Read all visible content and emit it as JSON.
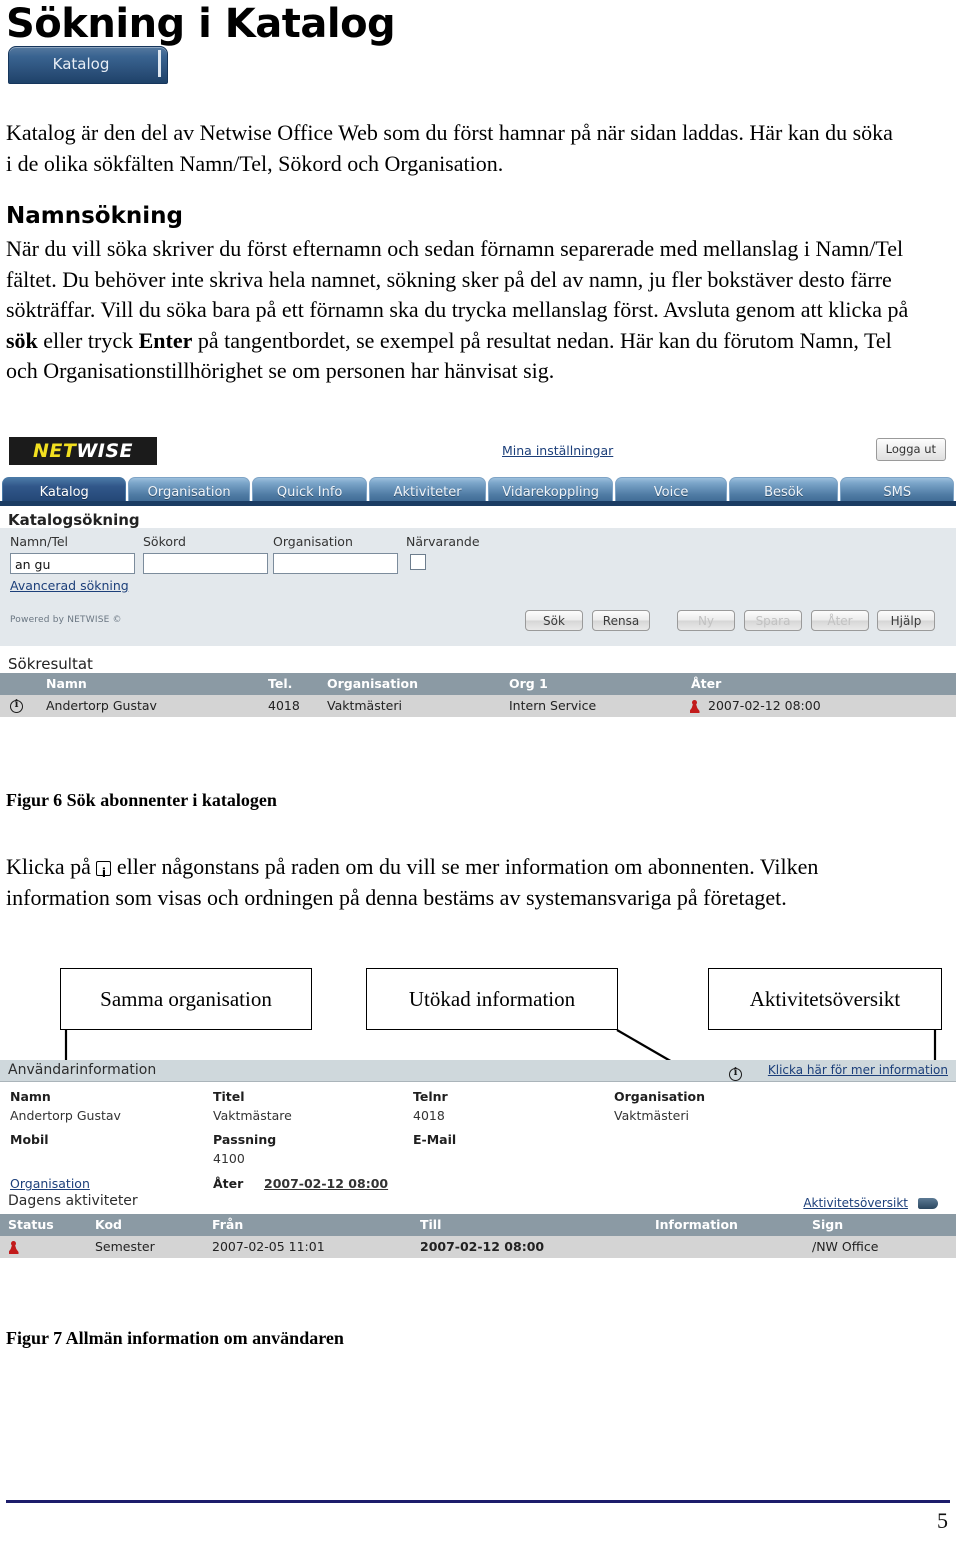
{
  "document": {
    "title": "Sökning i Katalog",
    "katalog_tab_label": "Katalog",
    "paragraph_1": "Katalog är den del av Netwise Office Web som du först hamnar på när sidan laddas. Här kan du söka i de olika sökfälten Namn/Tel, Sökord och Organisation.",
    "heading_namnsokning": "Namnsökning",
    "paragraph_2_a": "När du vill söka skriver du först efternamn och sedan förnamn separerade med mellanslag i Namn/Tel fältet. Du behöver inte skriva hela namnet, sökning sker på del av namn, ju fler bokstäver desto färre sökträffar. Vill du söka bara på ett förnamn ska du trycka mellanslag först. Avsluta genom att klicka på ",
    "paragraph_2_bold_1": "sök",
    "paragraph_2_b": " eller tryck ",
    "paragraph_2_bold_2": "Enter",
    "paragraph_2_c": " på tangentbordet, se exempel på resultat nedan. Här kan du förutom Namn, Tel och Organisationstillhörighet se om personen har hänvisat sig.",
    "figure_6_caption": "Figur 6  Sök abonnenter i katalogen",
    "paragraph_3_a": "Klicka på ",
    "paragraph_3_b": " eller någonstans på raden om du vill se mer information om abonnenten. Vilken information som visas och ordningen på denna bestäms av systemansvariga på företaget.",
    "figure_7_caption": "Figur 7 Allmän information om användaren",
    "page_number": "5"
  },
  "callouts": [
    {
      "label": "Samma organisation"
    },
    {
      "label": "Utökad information"
    },
    {
      "label": "Aktivitetsöversikt"
    }
  ],
  "app": {
    "logo": {
      "part1": "NET",
      "part2": "WISE"
    },
    "settings_link": "Mina inställningar",
    "logout_button": "Logga ut",
    "tabs": [
      {
        "label": "Katalog",
        "active": true
      },
      {
        "label": "Organisation",
        "active": false
      },
      {
        "label": "Quick Info",
        "active": false
      },
      {
        "label": "Aktiviteter",
        "active": false
      },
      {
        "label": "Vidarekoppling",
        "active": false
      },
      {
        "label": "Voice",
        "active": false
      },
      {
        "label": "Besök",
        "active": false
      },
      {
        "label": "SMS",
        "active": false
      }
    ],
    "search": {
      "title": "Katalogsökning",
      "fields": [
        {
          "label": "Namn/Tel",
          "value": "an gu"
        },
        {
          "label": "Sökord",
          "value": ""
        },
        {
          "label": "Organisation",
          "value": ""
        }
      ],
      "checkbox_label": "Närvarande",
      "advanced_link": "Avancerad sökning",
      "powered_by": "Powered by NETWISE ©",
      "buttons": [
        {
          "label": "Sök",
          "disabled": false
        },
        {
          "label": "Rensa",
          "disabled": false
        },
        {
          "label": "Ny",
          "disabled": true
        },
        {
          "label": "Spara",
          "disabled": true
        },
        {
          "label": "Åter",
          "disabled": true
        },
        {
          "label": "Hjälp",
          "disabled": false
        }
      ]
    },
    "results": {
      "title": "Sökresultat",
      "columns": [
        "Namn",
        "Tel.",
        "Organisation",
        "Org 1",
        "Åter"
      ],
      "row": {
        "namn": "Andertorp Gustav",
        "tel": "4018",
        "organisation": "Vaktmästeri",
        "org1": "Intern Service",
        "ater": "2007-02-12 08:00"
      }
    },
    "user_info": {
      "title": "Användarinformation",
      "more_info_link": "Klicka här för mer information",
      "labels": {
        "namn": "Namn",
        "titel": "Titel",
        "telnr": "Telnr",
        "organisation": "Organisation",
        "mobil": "Mobil",
        "passning": "Passning",
        "email": "E-Mail",
        "ater": "Åter"
      },
      "values": {
        "namn": "Andertorp Gustav",
        "titel": "Vaktmästare",
        "telnr": "4018",
        "organisation": "Vaktmästeri",
        "mobil": "",
        "passning": "4100",
        "email": "",
        "ater": "2007-02-12 08:00"
      },
      "organisation_link": "Organisation"
    },
    "activities": {
      "title": "Dagens aktiviteter",
      "overview_link": "Aktivitetsöversikt",
      "columns": [
        "Status",
        "Kod",
        "Från",
        "Till",
        "Information",
        "Sign"
      ],
      "row": {
        "status": "",
        "kod": "Semester",
        "fran": "2007-02-05 11:01",
        "till": "2007-02-12 08:00",
        "information": "",
        "sign": "/NW Office"
      }
    }
  },
  "colors": {
    "tab_active": "#1f4270",
    "header_gray": "#8b9aa4",
    "row_gray": "#d4d4d4",
    "panel_gray": "#e3e8ec",
    "bar_gray": "#cfd8dc",
    "link_blue": "#1c3f7a",
    "rule_navy": "#1d1d6b",
    "logo_yellow": "#f2e020",
    "status_red": "#c21b1b"
  }
}
